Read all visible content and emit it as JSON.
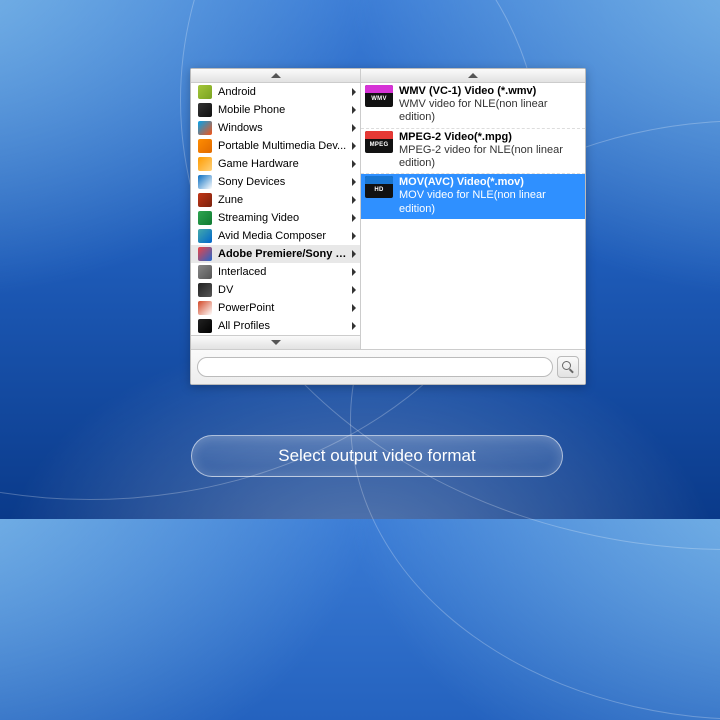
{
  "categories": [
    {
      "label": "Android",
      "icon": "android-icon",
      "color1": "#a4c639",
      "color2": "#7aa321"
    },
    {
      "label": "Mobile Phone",
      "icon": "phone-icon",
      "color1": "#333",
      "color2": "#111"
    },
    {
      "label": "Windows",
      "icon": "windows-icon",
      "color1": "#00a2ed",
      "color2": "#f65314"
    },
    {
      "label": "Portable Multimedia Dev...",
      "icon": "pmd-icon",
      "color1": "#ff8c00",
      "color2": "#e06a00"
    },
    {
      "label": "Game Hardware",
      "icon": "game-icon",
      "color1": "#ff9b00",
      "color2": "#ffd27a"
    },
    {
      "label": "Sony Devices",
      "icon": "sony-icon",
      "color1": "#0b6fc2",
      "color2": "#fff"
    },
    {
      "label": "Zune",
      "icon": "zune-icon",
      "color1": "#c23616",
      "color2": "#7a220e"
    },
    {
      "label": "Streaming Video",
      "icon": "stream-icon",
      "color1": "#2ea44f",
      "color2": "#0f7a32"
    },
    {
      "label": "Avid Media Composer",
      "icon": "avid-icon",
      "color1": "#4aa",
      "color2": "#06c"
    },
    {
      "label": "Adobe Premiere/Sony V...",
      "icon": "adobe-icon",
      "color1": "#e44",
      "color2": "#26c",
      "selected": true
    },
    {
      "label": "Interlaced",
      "icon": "interlaced-icon",
      "color1": "#888",
      "color2": "#555"
    },
    {
      "label": "DV",
      "icon": "dv-icon",
      "color1": "#222",
      "color2": "#555"
    },
    {
      "label": "PowerPoint",
      "icon": "ppt-icon",
      "color1": "#d24726",
      "color2": "#fff"
    },
    {
      "label": "All Profiles",
      "icon": "allprofiles-icon",
      "color1": "#222",
      "color2": "#000"
    }
  ],
  "formats": [
    {
      "title": "WMV (VC-1) Video (*.wmv)",
      "desc": "WMV video for NLE(non linear edition)",
      "thumb": "wmv",
      "thumb_label": "WMV"
    },
    {
      "title": "MPEG-2 Video(*.mpg)",
      "desc": "MPEG-2 video for NLE(non linear edition)",
      "thumb": "mpeg",
      "thumb_label": "MPEG"
    },
    {
      "title": "MOV(AVC) Video(*.mov)",
      "desc": "MOV  video for NLE(non linear edition)",
      "thumb": "hd",
      "thumb_label": "HD",
      "selected": true
    }
  ],
  "search": {
    "placeholder": ""
  },
  "cta_label": "Select output video format"
}
